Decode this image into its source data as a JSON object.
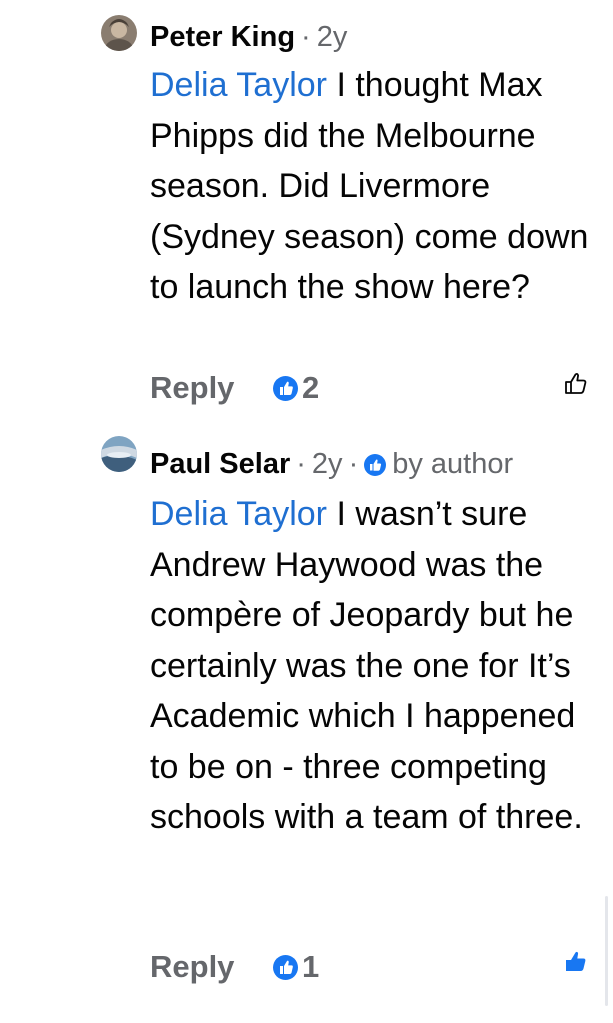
{
  "comments": [
    {
      "author": "Peter King",
      "age": "2y",
      "badge": null,
      "mention": "Delia Taylor",
      "text": "I thought Max Phipps did the Melbourne season. Did Livermore (Sydney season) come down to launch the show here?",
      "reply_label": "Reply",
      "reaction_count": "2",
      "liked": false
    },
    {
      "author": "Paul Selar",
      "age": "2y",
      "badge": "by author",
      "mention": "Delia Taylor",
      "text": "I wasn’t sure Andrew Haywood was the compère of Jeopardy but he certainly was the one for It’s Academic which I happened to be on - three competing schools with a team of three.",
      "reply_label": "Reply",
      "reaction_count": "1",
      "liked": true
    }
  ],
  "separator": "·",
  "colors": {
    "accent": "#1877f2",
    "mention": "#1f6fd1",
    "secondary_text": "#65676b",
    "primary_text": "#050505"
  }
}
